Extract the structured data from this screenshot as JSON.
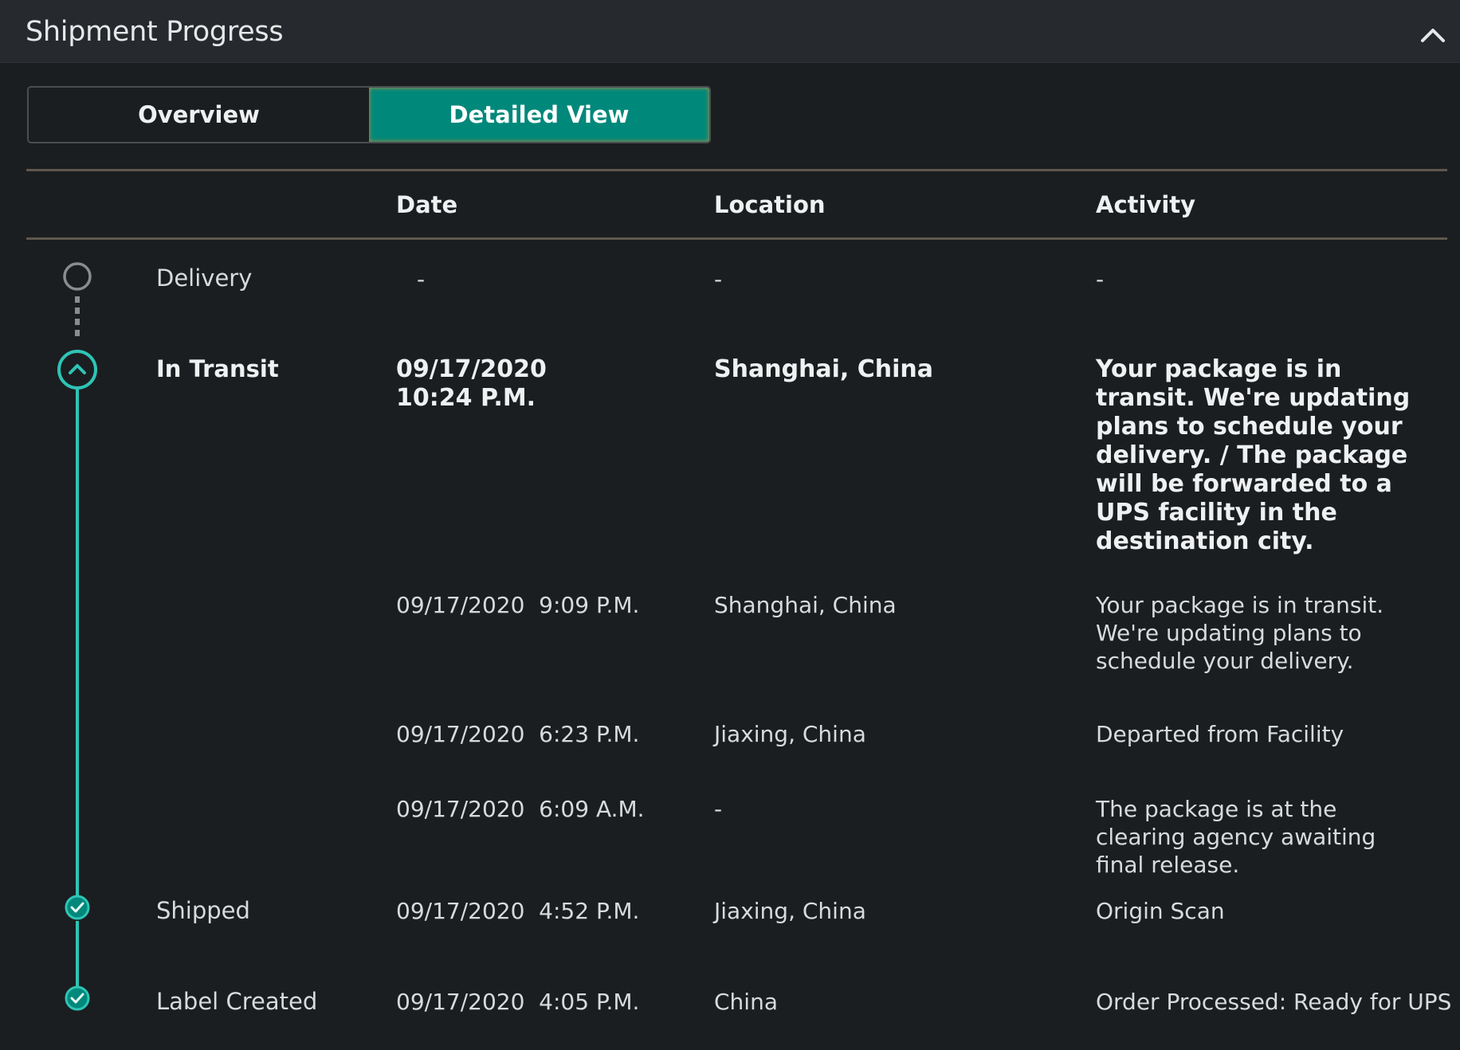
{
  "header": {
    "title": "Shipment Progress"
  },
  "tabs": {
    "overview": "Overview",
    "detailed": "Detailed View"
  },
  "columns": {
    "date": "Date",
    "location": "Location",
    "activity": "Activity"
  },
  "rows": [
    {
      "status": "Delivery",
      "date": "-",
      "location": "-",
      "activity": "-"
    },
    {
      "status": "In Transit",
      "date_line1": "09/17/2020",
      "date_line2": "10:24 P.M.",
      "location": "Shanghai, China",
      "activity": "Your package is in transit. We're updating plans to schedule your delivery. / The package will be forwarded to a UPS facility in the destination city."
    },
    {
      "date": "09/17/2020  9:09 P.M.",
      "location": "Shanghai, China",
      "activity": "Your package is in transit. We're updating plans to schedule your delivery."
    },
    {
      "date": "09/17/2020  6:23 P.M.",
      "location": "Jiaxing, China",
      "activity": "Departed from Facility"
    },
    {
      "date": "09/17/2020  6:09 A.M.",
      "location": "-",
      "activity": "The package is at the clearing agency awaiting final release."
    },
    {
      "status": "Shipped",
      "date": "09/17/2020  4:52 P.M.",
      "location": "Jiaxing, China",
      "activity": "Origin Scan"
    },
    {
      "status": "Label Created",
      "date": "09/17/2020  4:05 P.M.",
      "location": "China",
      "activity": "Order Processed: Ready for UPS"
    }
  ],
  "colors": {
    "accent": "#00887a",
    "timeline": "#2ec4b6"
  },
  "icons": {
    "collapse": "chevron-up-icon",
    "node_pending": "empty-circle-icon",
    "node_current": "chevron-up-circle-icon",
    "node_done": "check-circle-icon"
  }
}
